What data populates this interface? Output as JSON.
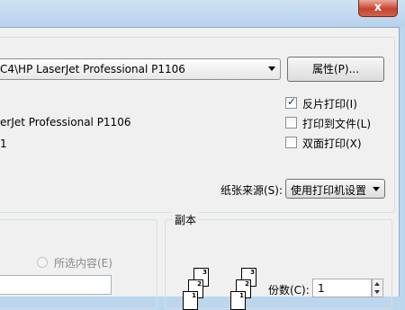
{
  "titlebar": {
    "close_glyph": "x"
  },
  "printer": {
    "name_value": "C4\\HP LaserJet Professional P1106",
    "properties_label": "属性(P)...",
    "type_value": "erJet Professional P1106",
    "where_value": "1"
  },
  "options": {
    "reverse_print": {
      "label": "反片打印(I)",
      "checked": true
    },
    "print_to_file": {
      "label": "打印到文件(L)",
      "checked": false
    },
    "duplex": {
      "label": "双面打印(X)",
      "checked": false
    }
  },
  "paper_source": {
    "label": "纸张来源(S):",
    "value": "使用打印机设置"
  },
  "page_range": {
    "selection_label": "所选内容(E)",
    "pages_value": ""
  },
  "copies": {
    "group_title": "副本",
    "count_label": "份数(C):",
    "count_value": "1",
    "collate_pages_a": [
      "3",
      "2",
      "1"
    ],
    "collate_pages_b": [
      "3",
      "2",
      "1"
    ]
  },
  "icons": {
    "checkbox_mark": "✓"
  }
}
